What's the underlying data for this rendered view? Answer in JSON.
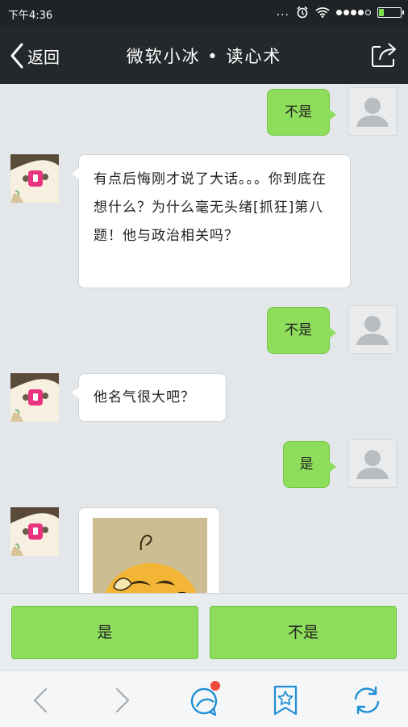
{
  "status_bar": {
    "time": "下午4:36",
    "more": "...",
    "colors": {
      "battery": "#7de04c"
    }
  },
  "header": {
    "back_label": "返回",
    "title": "微软小冰 • 读心术",
    "share_icon": "share-icon"
  },
  "chat": {
    "messages": [
      {
        "sender": "user",
        "text": "不是"
      },
      {
        "sender": "bot",
        "text": "有点后悔刚才说了大话。。。你到底在想什么？为什么毫无头绪[抓狂]第八题！他与政治相关吗？"
      },
      {
        "sender": "user",
        "text": "不是"
      },
      {
        "sender": "bot",
        "text": "他名气很大吧？"
      },
      {
        "sender": "user",
        "text": "是"
      },
      {
        "sender": "bot",
        "type": "image",
        "image": "psyduck-sticker"
      }
    ],
    "colors": {
      "user_bubble": "#8ede5c",
      "bot_bubble": "#ffffff"
    }
  },
  "answers": {
    "yes_label": "是",
    "no_label": "不是"
  },
  "bottom_nav": {
    "items": [
      "back-arrow-icon",
      "forward-arrow-icon",
      "chat-app-icon",
      "bookmark-star-icon",
      "refresh-icon"
    ],
    "badge_color": "#f04b3c",
    "accent": "#1f8fd6"
  }
}
